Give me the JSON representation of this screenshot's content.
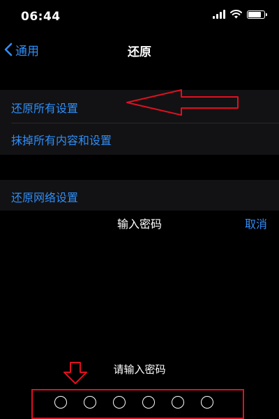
{
  "status_bar": {
    "time": "06:44"
  },
  "nav": {
    "back_label": "通用",
    "title": "还原"
  },
  "settings": {
    "group1": [
      {
        "label": "还原所有设置"
      },
      {
        "label": "抹掉所有内容和设置"
      }
    ],
    "group2": [
      {
        "label": "还原网络设置"
      }
    ]
  },
  "passcode_sheet": {
    "title": "输入密码",
    "cancel_label": "取消",
    "prompt": "请输入密码",
    "dot_count": 6
  },
  "colors": {
    "accent": "#2f8ef7",
    "annotation": "#e01020",
    "background": "#000000",
    "group_background": "#121214"
  },
  "icons": {
    "back": "chevron-left-icon",
    "signal": "cellular-signal-icon",
    "wifi": "wifi-icon",
    "battery": "battery-icon"
  }
}
